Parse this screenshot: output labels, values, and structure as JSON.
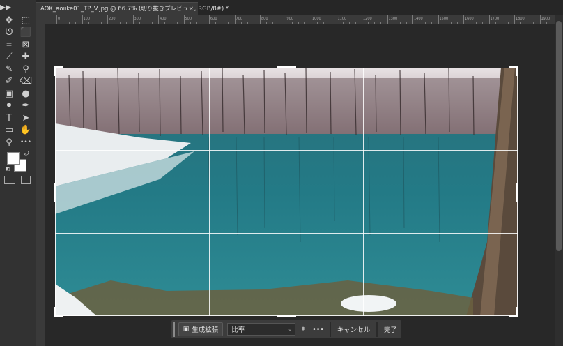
{
  "document_tab": {
    "title": "AOK_aoiike01_TP_V.jpg @ 66.7% (切り抜きプレビュー, RGB/8#) *",
    "close": "×"
  },
  "ruler": {
    "labels": [
      "0",
      "100",
      "200",
      "300",
      "400",
      "500",
      "600",
      "700",
      "800",
      "900",
      "1000",
      "1100",
      "1200",
      "1300",
      "1400",
      "1500",
      "1600",
      "1700",
      "1800",
      "1900"
    ]
  },
  "tools": [
    {
      "name": "move-tool-icon",
      "glyph": "✥"
    },
    {
      "name": "marquee-tool-icon",
      "glyph": "⬚"
    },
    {
      "name": "lasso-tool-icon",
      "glyph": "ᘎ"
    },
    {
      "name": "object-select-tool-icon",
      "glyph": "⬛"
    },
    {
      "name": "crop-tool-icon",
      "glyph": "⌗"
    },
    {
      "name": "frame-tool-icon",
      "glyph": "⊠"
    },
    {
      "name": "eyedropper-tool-icon",
      "glyph": "⟋"
    },
    {
      "name": "spot-heal-tool-icon",
      "glyph": "✚"
    },
    {
      "name": "brush-tool-icon",
      "glyph": "✎"
    },
    {
      "name": "stamp-tool-icon",
      "glyph": "⚲"
    },
    {
      "name": "history-brush-tool-icon",
      "glyph": "✐"
    },
    {
      "name": "eraser-tool-icon",
      "glyph": "⌫"
    },
    {
      "name": "gradient-tool-icon",
      "glyph": "▣"
    },
    {
      "name": "blur-tool-icon",
      "glyph": "●"
    },
    {
      "name": "dodge-tool-icon",
      "glyph": "⚫"
    },
    {
      "name": "pen-tool-icon",
      "glyph": "✒"
    },
    {
      "name": "type-tool-icon",
      "glyph": "T"
    },
    {
      "name": "path-select-tool-icon",
      "glyph": "➤"
    },
    {
      "name": "shape-tool-icon",
      "glyph": "▭"
    },
    {
      "name": "hand-tool-icon",
      "glyph": "✋"
    },
    {
      "name": "zoom-tool-icon",
      "glyph": "⚲"
    },
    {
      "name": "more-tools-icon",
      "glyph": "•••"
    }
  ],
  "context_bar": {
    "generative_expand_label": "生成拡張",
    "ratio_value": "比率",
    "cancel_label": "キャンセル",
    "done_label": "完了",
    "more_label": "•••"
  },
  "colors": {
    "foreground": "#ffffff",
    "background": "#ffffff"
  }
}
